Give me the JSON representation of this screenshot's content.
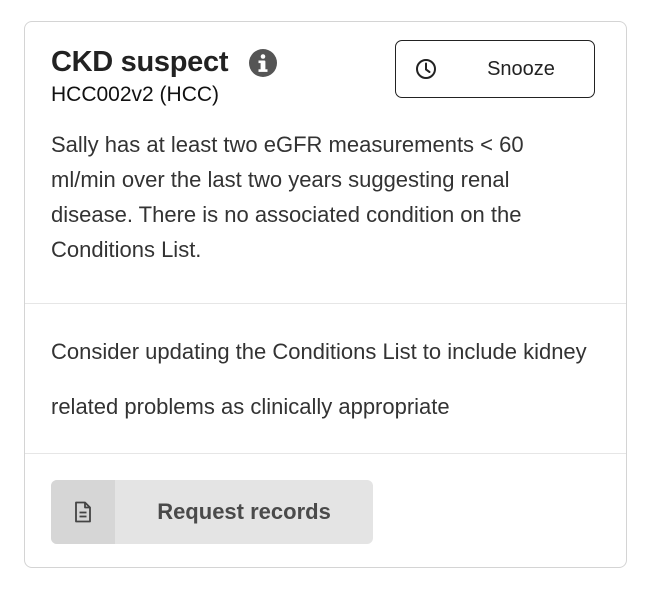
{
  "card": {
    "title": "CKD suspect",
    "subtitle": "HCC002v2  (HCC)",
    "snooze_label": "Snooze",
    "description": "Sally has at least two eGFR measurements < 60 ml/min over the last two years suggesting renal disease. There is no associated condition on the Conditions List.",
    "recommendation": "Consider updating the Conditions List to include kidney related problems as clinically appropriate",
    "request_records_label": "Request records"
  },
  "icons": {
    "info": "info-icon",
    "snooze": "clock-icon",
    "request": "document-icon"
  },
  "colors": {
    "border": "#d4d4d4",
    "button_gray": "#e4e4e4",
    "text_dark": "#222222"
  }
}
